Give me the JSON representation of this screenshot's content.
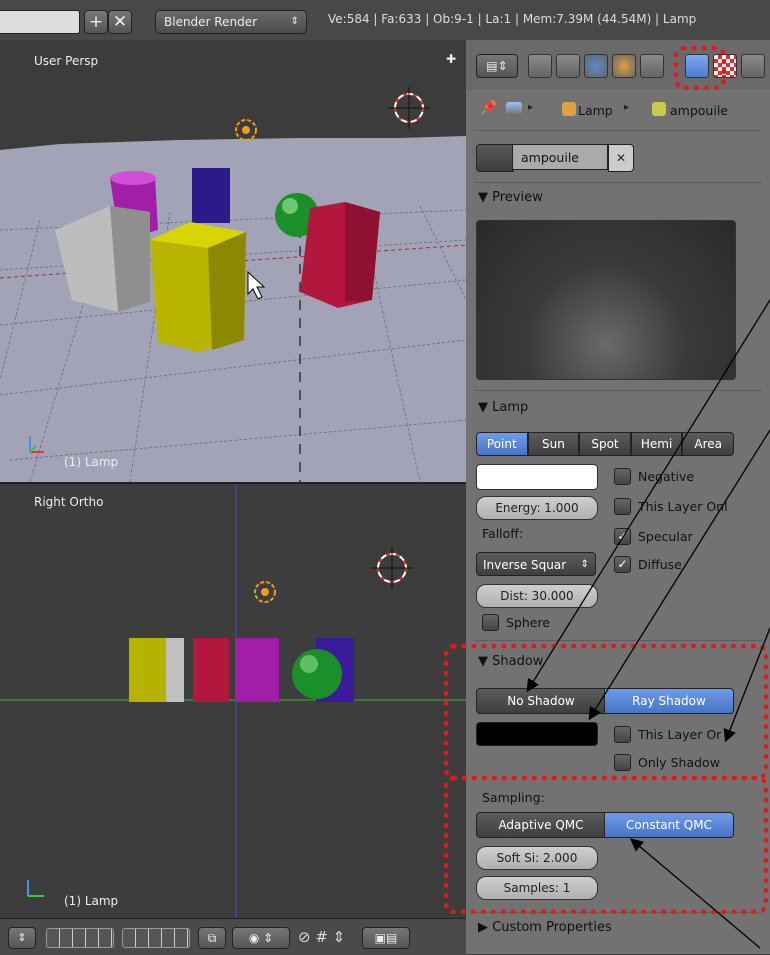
{
  "header": {
    "render_engine": "Blender Render",
    "stats": "Ve:584 | Fa:633 | Ob:9-1 | La:1 | Mem:7.39M (44.54M) | Lamp"
  },
  "viewport_top": {
    "label": "User Persp",
    "object_label": "(1) Lamp"
  },
  "viewport_bottom": {
    "label": "Right Ortho",
    "object_label": "(1) Lamp"
  },
  "properties": {
    "breadcrumb": {
      "lamp": "Lamp",
      "object": "ampouile"
    },
    "datablock_name": "ampouile",
    "preview": {
      "title": "Preview"
    },
    "lamp": {
      "title": "Lamp",
      "types": [
        "Point",
        "Sun",
        "Spot",
        "Hemi",
        "Area"
      ],
      "active_type": "Point",
      "energy": "Energy: 1.000",
      "falloff_label": "Falloff:",
      "falloff_value": "Inverse Squar",
      "distance": "Dist: 30.000",
      "sphere": "Sphere",
      "negative": "Negative",
      "this_layer": "This Layer Onl",
      "specular": "Specular",
      "diffuse": "Diffuse",
      "color": "#ffffff"
    },
    "shadow": {
      "title": "Shadow",
      "no_shadow": "No Shadow",
      "ray_shadow": "Ray Shadow",
      "active": "Ray Shadow",
      "this_layer": "This Layer Or",
      "only_shadow": "Only Shadow",
      "color": "#000000",
      "sampling_label": "Sampling:",
      "adaptive": "Adaptive QMC",
      "constant": "Constant QMC",
      "soft_size": "Soft Si: 2.000",
      "samples": "Samples: 1"
    },
    "custom_properties": "Custom Properties"
  },
  "colors": {
    "accent": "#4c7bd0",
    "annotation": "#e5171d",
    "panel": "#727272"
  }
}
